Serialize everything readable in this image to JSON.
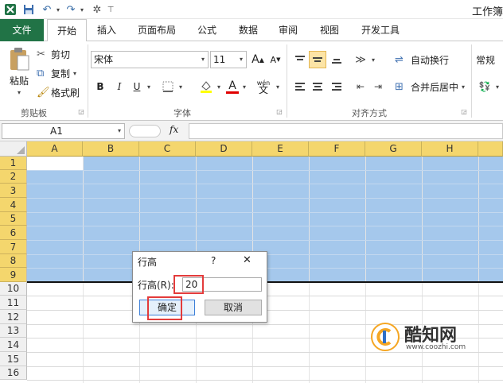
{
  "window": {
    "title": "工作簿"
  },
  "quick_access": {
    "app_icon": "excel-icon",
    "save_icon": "save-icon",
    "undo_icon": "undo-icon",
    "redo_icon": "redo-icon",
    "customize_icon": "tools-icon"
  },
  "tabs": [
    "文件",
    "开始",
    "插入",
    "页面布局",
    "公式",
    "数据",
    "审阅",
    "视图",
    "开发工具"
  ],
  "ribbon": {
    "clipboard": {
      "paste": "粘贴",
      "cut": "剪切",
      "copy": "复制",
      "format_painter": "格式刷",
      "label": "剪贴板"
    },
    "font": {
      "name": "宋体",
      "size": "11",
      "bold": "B",
      "italic": "I",
      "underline": "U",
      "font_color_glyph": "A",
      "phonetic": "wén",
      "label": "字体"
    },
    "alignment": {
      "wrap_text": "自动换行",
      "merge_center": "合并后居中",
      "label": "对齐方式"
    },
    "number": {
      "format": "常规"
    }
  },
  "formula_bar": {
    "name_box": "A1",
    "fx": "fx",
    "formula": ""
  },
  "sheet": {
    "columns": [
      "A",
      "B",
      "C",
      "D",
      "E",
      "F",
      "G",
      "H"
    ],
    "rows": [
      "1",
      "2",
      "3",
      "4",
      "5",
      "6",
      "7",
      "8",
      "9",
      "10",
      "11",
      "12",
      "13",
      "14",
      "15",
      "16"
    ],
    "selected_rows": 9,
    "colors": {
      "selection": "#a5c8ec",
      "header_highlight": "#f4d66d",
      "header": "#f0f0f0"
    }
  },
  "dialog": {
    "title": "行高",
    "help": "?",
    "close": "✕",
    "field_label": "行高(R):",
    "field_value": "20",
    "ok": "确定",
    "cancel": "取消"
  },
  "watermark": {
    "brand": "酷知网",
    "url": "www.coozhi.com"
  }
}
